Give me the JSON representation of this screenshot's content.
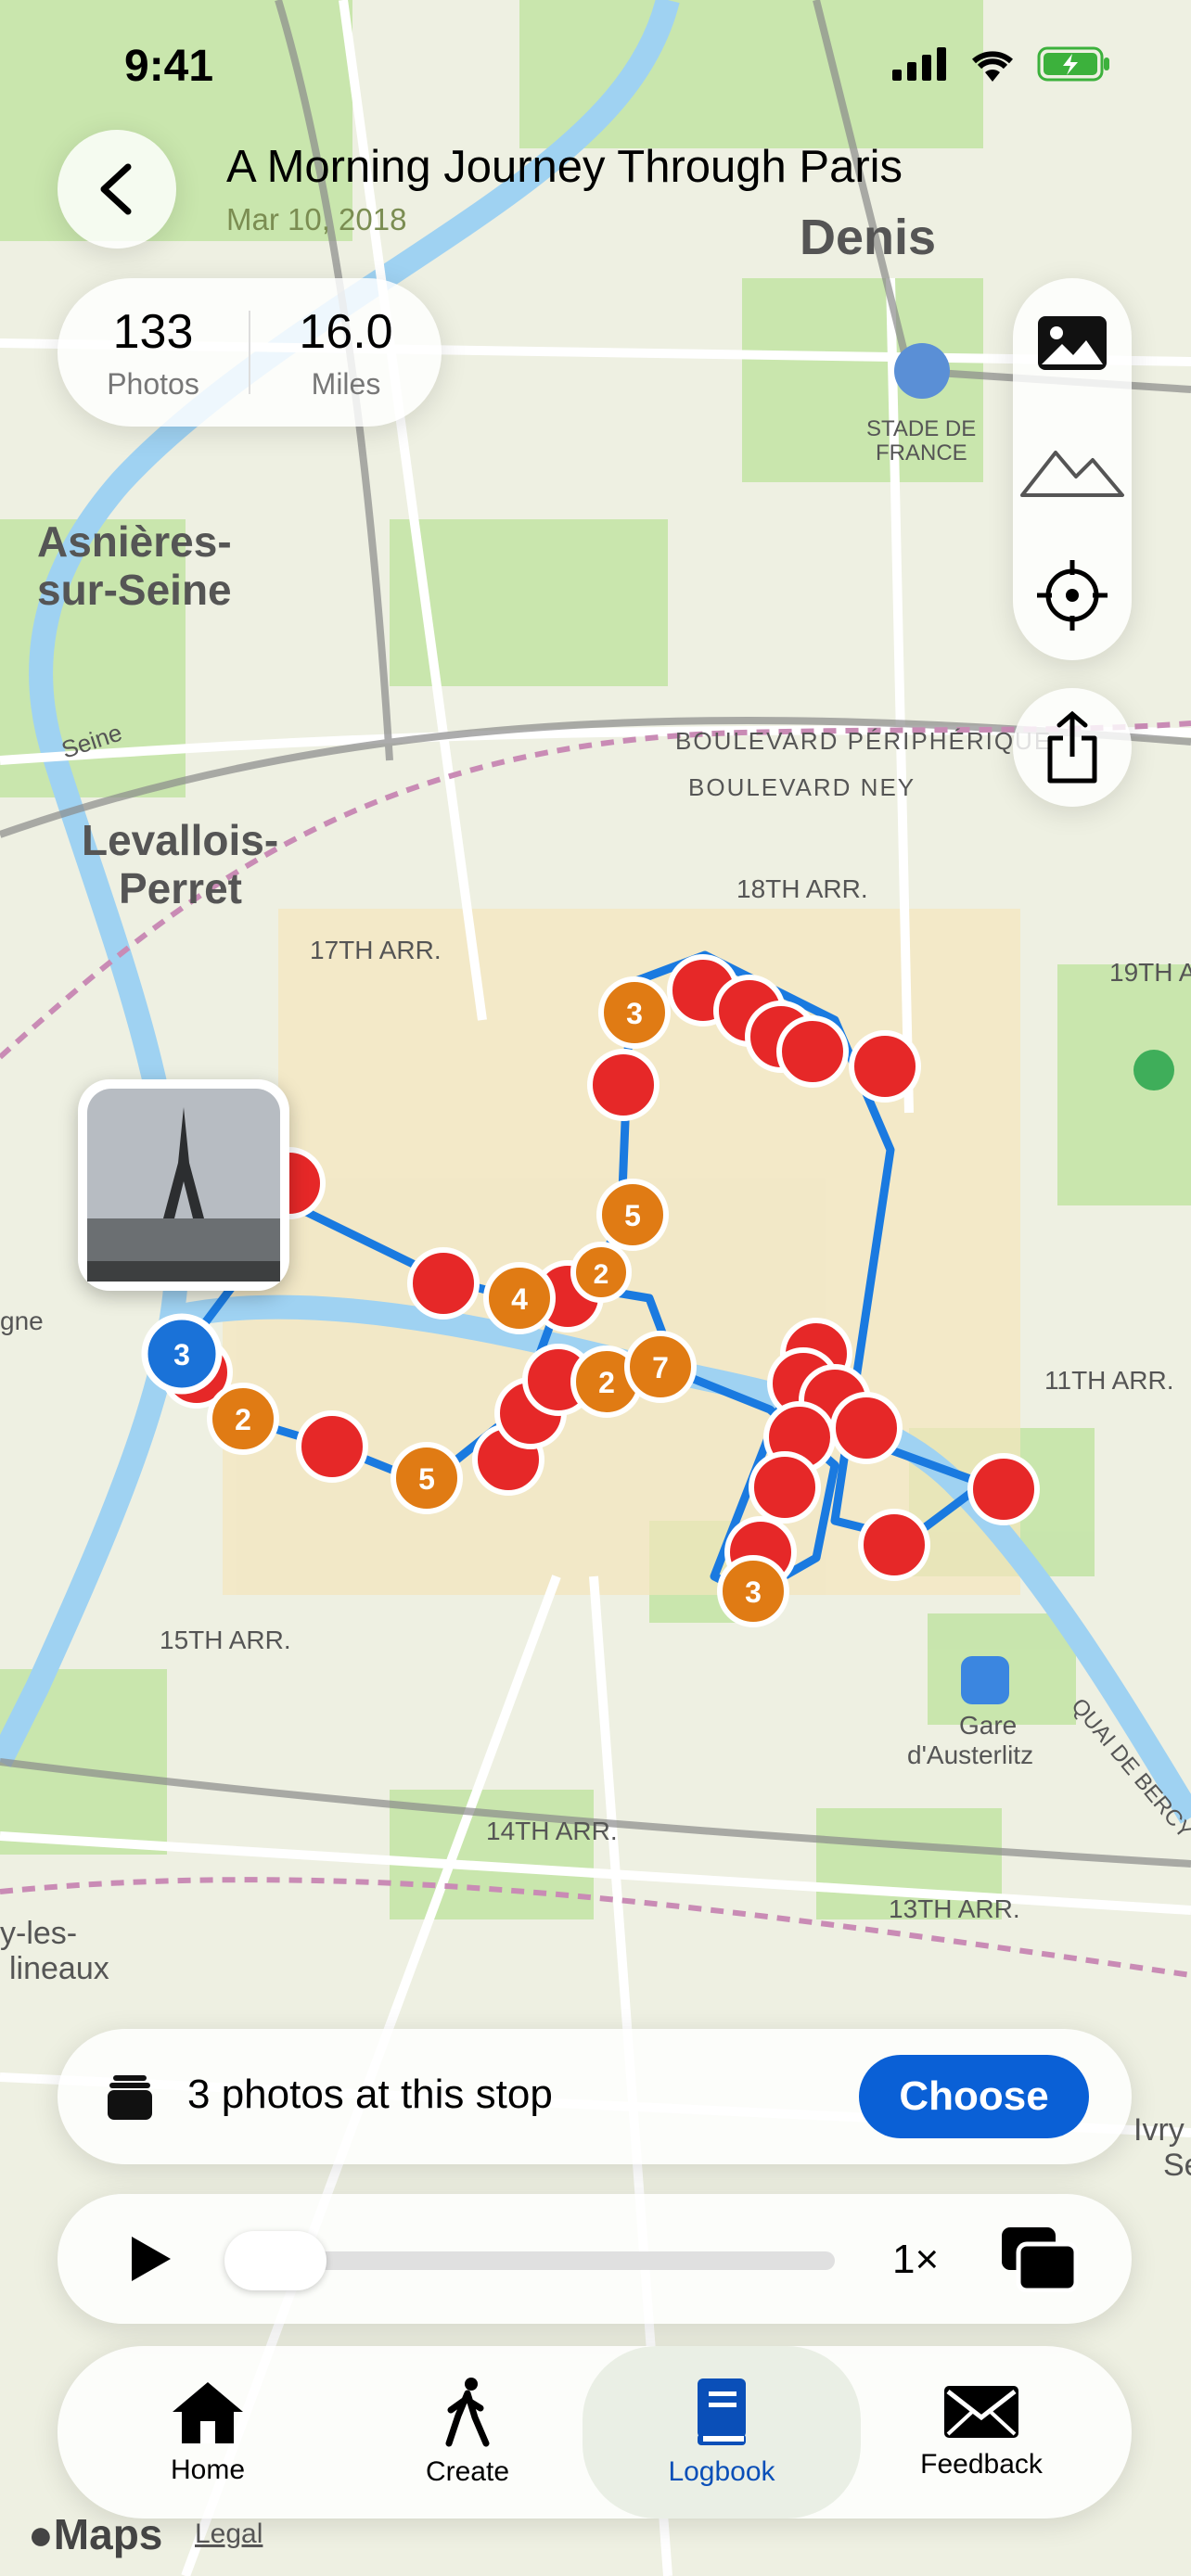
{
  "status": {
    "time": "9:41"
  },
  "header": {
    "title": "A Morning Journey Through Paris",
    "date": "Mar 10, 2018"
  },
  "stats": [
    {
      "value": "133",
      "label": "Photos"
    },
    {
      "value": "16.0",
      "label": "Miles"
    }
  ],
  "map_labels": {
    "asnieres": [
      "Asnières-",
      "sur-Seine"
    ],
    "levallois": [
      "Levallois-",
      "Perret"
    ],
    "denis": "Denis",
    "stade": [
      "STADE DE",
      "FRANCE"
    ],
    "seine": "Seine",
    "periph": "BOULEVARD PÉRIPHÉRIQUE",
    "ney": "BOULEVARD NEY",
    "arr18": "18TH ARR.",
    "arr17": "17TH ARR.",
    "arr19": "19TH AR",
    "arr11": "11TH ARR.",
    "arr15": "15TH ARR.",
    "arr14": "14TH ARR.",
    "arr13": "13TH ARR.",
    "gare": [
      "Gare",
      "d'Austerlitz"
    ],
    "quai": "QUAI DE BERCY",
    "gne": "gne",
    "moulineaux": [
      "y-les-",
      "lineaux"
    ],
    "ivry": [
      "Ivry",
      "Se"
    ]
  },
  "pins": [
    {
      "label": "3",
      "color": "orange"
    },
    {
      "label": "5",
      "color": "orange"
    },
    {
      "label": "4",
      "color": "orange"
    },
    {
      "label": "2",
      "color": "orange"
    },
    {
      "label": "2",
      "color": "orange"
    },
    {
      "label": "7",
      "color": "orange"
    },
    {
      "label": "2",
      "color": "orange"
    },
    {
      "label": "5",
      "color": "orange"
    },
    {
      "label": "3",
      "color": "orange"
    },
    {
      "label": "3",
      "color": "blue"
    }
  ],
  "stop": {
    "text": "3 photos at this stop",
    "action": "Choose"
  },
  "player": {
    "speed": "1×",
    "progress": 0.0
  },
  "tabs": [
    {
      "label": "Home",
      "icon": "house-icon"
    },
    {
      "label": "Create",
      "icon": "walk-icon"
    },
    {
      "label": "Logbook",
      "icon": "book-icon"
    },
    {
      "label": "Feedback",
      "icon": "envelope-icon"
    }
  ],
  "footer": {
    "maps": "Maps",
    "legal": "Legal"
  },
  "colors": {
    "accent": "#0a60d6",
    "route": "#1a7ae0",
    "pin_red": "#e62828",
    "pin_orange": "#e07b14"
  }
}
